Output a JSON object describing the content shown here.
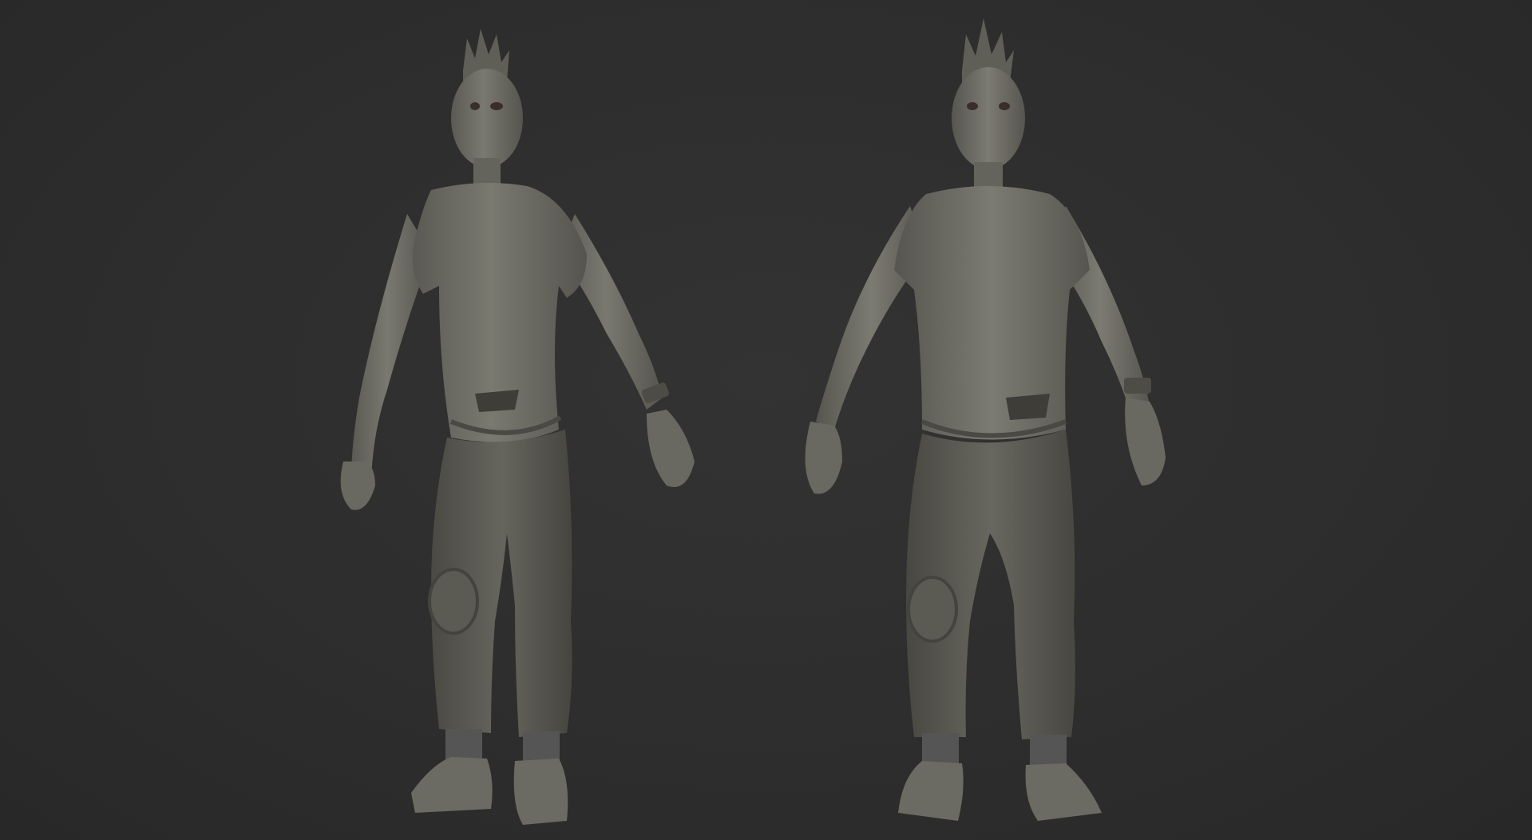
{
  "scene": {
    "background_color": "#2c2c2c",
    "clay_color": "#6f6e66",
    "clay_shadow": "#4a4943",
    "clay_highlight": "#8a897f",
    "figures": [
      {
        "view": "three-quarter"
      },
      {
        "view": "front"
      }
    ]
  }
}
